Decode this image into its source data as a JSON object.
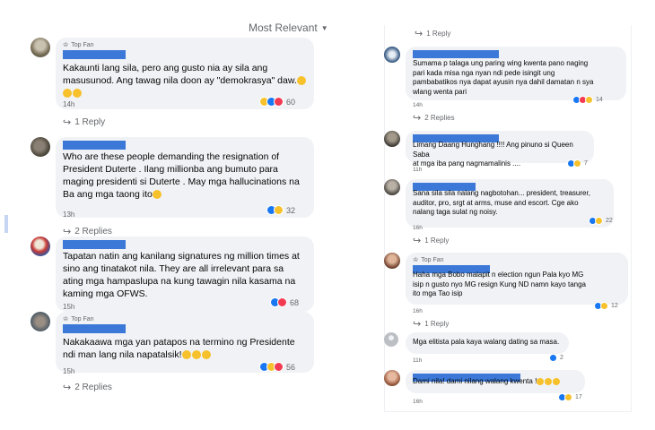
{
  "sort": {
    "label": "Most Relevant"
  },
  "left_comments": [
    {
      "avatar": "avatar-photo-outdoor",
      "badge": "Top Fan",
      "text": "Kakaunti lang sila, pero ang gusto nia ay sila ang\nmasusunod. Ang tawag nila doon ay \"demokrasya\" daw.",
      "emojis": [
        "laughing-emoji",
        "laughing-emoji",
        "laughing-emoji"
      ],
      "time": "14h",
      "reactions": [
        "haha",
        "like",
        "love"
      ],
      "count": "60",
      "replies": "1 Reply"
    },
    {
      "avatar": "avatar-photo-person",
      "badge": "",
      "text": "Who are these people demanding the resignation of\nPresident Duterte . Ilang millionba ang bumuto para\nmaging presidenti si Duterte . May mga hallucinations na\nBa ang mga taong ito",
      "emojis": [
        "laughing-emoji"
      ],
      "time": "13h",
      "reactions": [
        "like",
        "haha"
      ],
      "count": "32",
      "replies": "2 Replies"
    },
    {
      "avatar": "avatar-cartoon",
      "badge": "",
      "text": "Tapatan natin ang kanilang signatures ng million times at\nsino ang tinatakot nila. They are all irrelevant para sa\nating mga hampaslupa na kung tawagin nila kasama na\nkaming mga OFWS.",
      "emojis": [],
      "time": "15h",
      "reactions": [
        "like",
        "love"
      ],
      "count": "68",
      "replies": ""
    },
    {
      "avatar": "avatar-photo-group",
      "badge": "Top Fan",
      "text": "Nakakaawa mga yan patapos na termino ng Presidente\nndi man lang nila napatalsik!",
      "emojis": [
        "laughing-emoji",
        "laughing-emoji",
        "laughing-emoji"
      ],
      "time": "15h",
      "reactions": [
        "like",
        "haha",
        "love"
      ],
      "count": "56",
      "replies": "2 Replies"
    }
  ],
  "right_top_reply": "1 Reply",
  "right_comments": [
    {
      "avatar": "avatar-photo-blue",
      "badge": "",
      "text": "Sumama p talaga ung paring wing kwenta pano naging\npari kada misa nga nyan ndi pede isingit ung\npambabatikos nya dapat ayusin nya dahil damatan n sya\nwlang wenta pari",
      "emojis": [],
      "time": "14h",
      "reactions": [
        "like",
        "love",
        "haha"
      ],
      "count": "14",
      "replies": "2 Replies"
    },
    {
      "avatar": "avatar-photo-man",
      "badge": "",
      "text": "Limang Daang Hunghang !!!! Ang pinuno si Queen Saba\nat mga iba pang nagmamalinis ....",
      "emojis": [],
      "time": "11h",
      "reactions": [
        "like",
        "haha"
      ],
      "count": "7",
      "replies": ""
    },
    {
      "avatar": "avatar-photo-man-2",
      "badge": "",
      "text": "Sana sila sila nalang nagbotohan... president, treasurer,\nauditor, pro, srgt at arms, muse and escort. Cge ako\nnalang taga sulat ng noisy.",
      "emojis": [],
      "time": "16h",
      "reactions": [
        "like",
        "haha"
      ],
      "count": "22",
      "replies": "1 Reply"
    },
    {
      "avatar": "avatar-photo-woman",
      "badge": "Top Fan",
      "text": "Haha mga Bobo malapit n election ngun Pala kyo MG\nisip n gusto nyo MG resign Kung ND namn kayo tanga\nito mga Tao isip",
      "emojis": [],
      "time": "16h",
      "reactions": [
        "like",
        "haha"
      ],
      "count": "12",
      "replies": "1 Reply"
    },
    {
      "avatar": "avatar-default",
      "badge": "",
      "text": "Mga elitista pala kaya walang dating sa masa.",
      "emojis": [],
      "time": "11h",
      "reactions": [
        "like"
      ],
      "count": "2",
      "replies": ""
    },
    {
      "avatar": "avatar-photo-woman-2",
      "badge": "",
      "text": "Dami nila! dami nilang walang kwenta !",
      "emojis": [
        "laughing-emoji",
        "laughing-emoji",
        "laughing-emoji"
      ],
      "time": "16h",
      "reactions": [
        "like",
        "haha"
      ],
      "count": "17",
      "replies": ""
    }
  ],
  "colors": {
    "bubble": "#f0f2f5",
    "name_redaction": "#3b78d8",
    "meta_text": "#65676b",
    "like": "#1877f2",
    "love": "#f23a52",
    "haha": "#f7c12c",
    "angry": "#f0792e"
  }
}
